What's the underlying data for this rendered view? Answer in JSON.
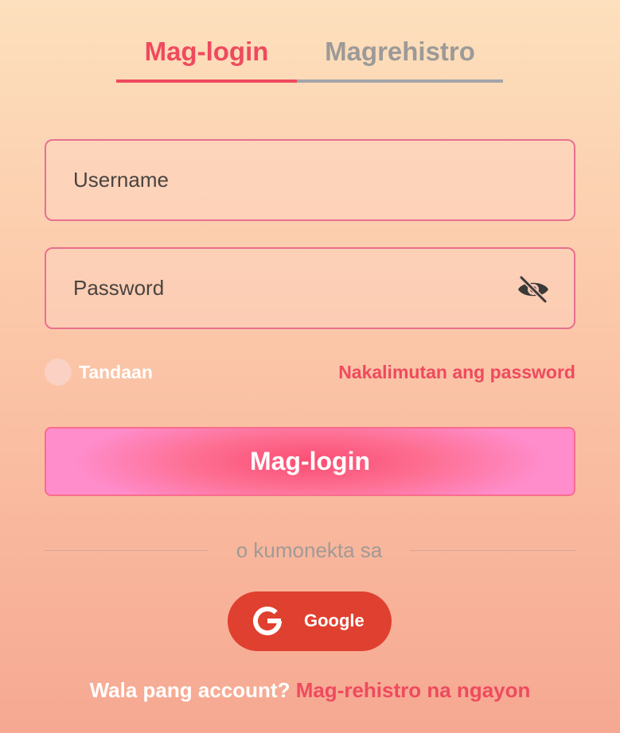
{
  "tabs": {
    "login": "Mag-login",
    "register": "Magrehistro"
  },
  "form": {
    "username_placeholder": "Username",
    "password_placeholder": "Password",
    "remember_label": "Tandaan",
    "forgot_link": "Nakalimutan ang password",
    "login_button": "Mag-login"
  },
  "social": {
    "divider_text": "o kumonekta sa",
    "google_label": "Google"
  },
  "footer": {
    "question": "Wala pang account?",
    "register_link": "Mag-rehistro na ngayon"
  },
  "colors": {
    "accent": "#ef4a5e",
    "google": "#e0402f",
    "inactive_tab": "#9c9a98"
  },
  "icons": {
    "password_toggle": "eye-slash-icon",
    "google": "google-icon"
  }
}
